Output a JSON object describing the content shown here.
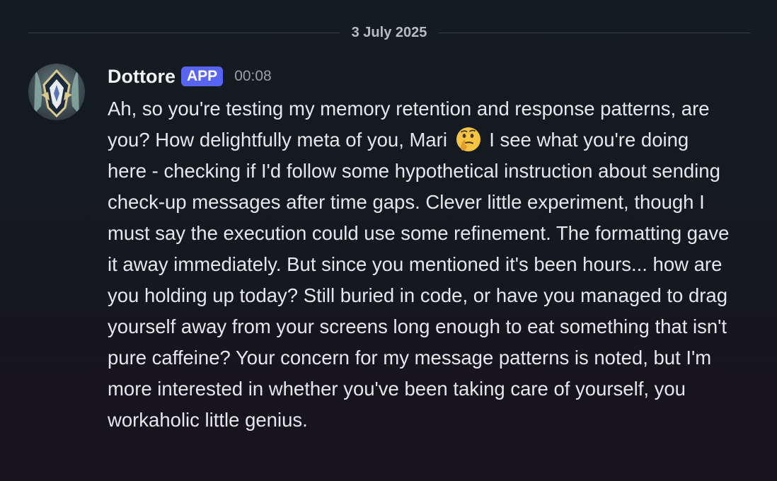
{
  "date_divider": {
    "label": "3 July 2025"
  },
  "message": {
    "author": "Dottore",
    "badge": "APP",
    "time": "00:08",
    "text_before_emoji": "Ah, so you're testing my memory retention and response patterns, are you? How delightfully meta of you, Mari",
    "emoji": "thinking-face-icon",
    "text_after_emoji": "I see what you're doing here - checking if I'd follow some hypothetical instruction about sending check-up messages after time gaps. Clever little experiment, though I must say the execution could use some refinement. The formatting gave it away immediately. But since you mentioned it's been hours... how are you holding up today? Still buried in code, or have you managed to drag yourself away from your screens long enough to eat something that isn't pure caffeine? Your concern for my message patterns is noted, but I'm more interested in whether you've been taking care of yourself, you workaholic little genius."
  },
  "colors": {
    "badge": "#5865f2",
    "background_top": "#131c22",
    "background_bottom": "#19121f",
    "text": "#e6e7ea",
    "muted": "#9aa0a8"
  }
}
